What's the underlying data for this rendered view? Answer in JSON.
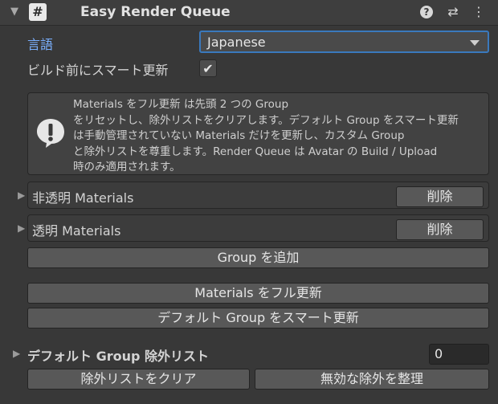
{
  "header": {
    "title": "Easy Render Queue",
    "component_icon": "#",
    "icons": [
      "fold-arrow-icon",
      "help-icon",
      "preset-icon",
      "more-menu-icon"
    ]
  },
  "language": {
    "label": "言語",
    "value": "Japanese"
  },
  "smart_update_before_build": {
    "label": "ビルド前にスマート更新",
    "checked": true
  },
  "help": {
    "icon": "warning-icon",
    "lines": [
      "Materials をフル更新 は先頭 2 つの Group",
      "をリセットし、除外リストをクリアします。デフォルト Group をスマート更新",
      "は手動管理されていない Materials だけを更新し、カスタム Group",
      "と除外リストを尊重します。Render Queue は Avatar の Build / Upload",
      "時のみ適用されます。"
    ]
  },
  "groups": [
    {
      "label": "非透明 Materials",
      "delete_label": "削除"
    },
    {
      "label": "透明 Materials",
      "delete_label": "削除"
    }
  ],
  "buttons": {
    "add_group": "Group を追加",
    "full_update": "Materials をフル更新",
    "smart_update": "デフォルト Group をスマート更新",
    "clear_exclusion": "除外リストをクリア",
    "cleanup_invalid": "無効な除外を整理"
  },
  "exclusion": {
    "label": "デフォルト Group 除外リスト",
    "count": "0"
  },
  "colors": {
    "accent_focus": "#3a79bd",
    "label_link": "#7ab0ff",
    "panel_bg": "#383838"
  }
}
